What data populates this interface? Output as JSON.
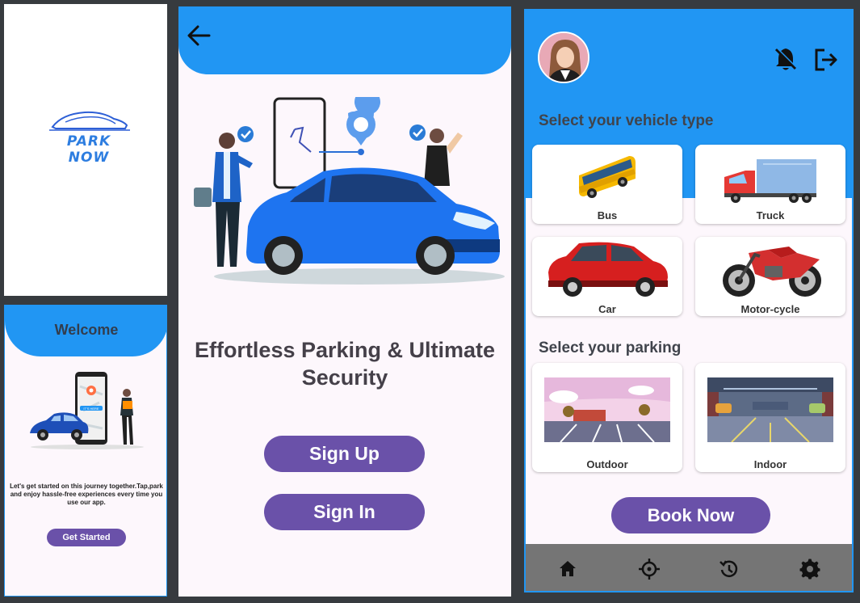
{
  "splash": {
    "logo_text": "PARK NOW"
  },
  "welcome": {
    "title": "Welcome",
    "description": "Let's get started on this journey together.Tap,park and enjoy hassle-free experiences every time you use our app.",
    "cta_label": "Get Started",
    "illustration_text": "IT'S HERE"
  },
  "auth": {
    "headline": "Effortless Parking & Ultimate Security",
    "sign_up_label": "Sign Up",
    "sign_in_label": "Sign In"
  },
  "home": {
    "vehicle_section_title": "Select your vehicle type",
    "vehicles": [
      {
        "label": "Bus",
        "icon": "bus-icon"
      },
      {
        "label": "Truck",
        "icon": "truck-icon"
      },
      {
        "label": "Car",
        "icon": "car-icon"
      },
      {
        "label": "Motor-cycle",
        "icon": "motorcycle-icon"
      }
    ],
    "parking_section_title": "Select your parking",
    "parkings": [
      {
        "label": "Outdoor"
      },
      {
        "label": "Indoor"
      }
    ],
    "book_label": "Book Now",
    "nav": [
      "home-icon",
      "location-icon",
      "history-icon",
      "settings-icon"
    ]
  },
  "colors": {
    "primary_blue": "#2196f3",
    "button_purple": "#6a51a9",
    "nav_gray": "#757575",
    "background": "#fdf7fc"
  }
}
